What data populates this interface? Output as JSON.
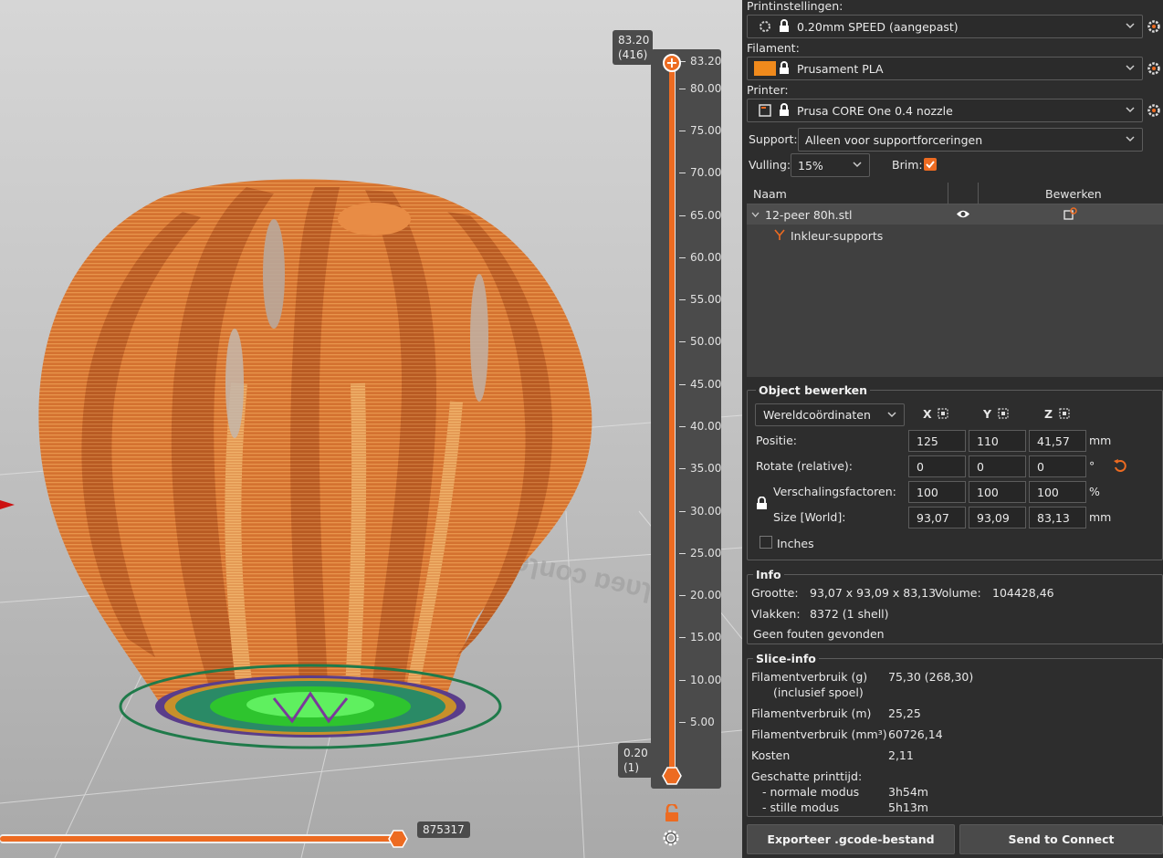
{
  "viewport": {
    "layer_slider": {
      "top_value": "83.20",
      "top_layer": "(416)",
      "bottom_value": "0.20",
      "bottom_layer": "(1)",
      "ticks": [
        "83.20",
        "80.00",
        "75.00",
        "70.00",
        "65.00",
        "60.00",
        "55.00",
        "50.00",
        "45.00",
        "40.00",
        "35.00",
        "30.00",
        "25.00",
        "20.00",
        "15.00",
        "10.00",
        "5.00"
      ]
    },
    "move_slider": {
      "value": "875317"
    },
    "bed_label": "ɿəɿuoɔ ɒɘυɿq"
  },
  "sidebar": {
    "print_settings": {
      "label": "Printinstellingen:",
      "value": "0.20mm SPEED (aangepast)"
    },
    "filament": {
      "label": "Filament:",
      "value": "Prusament PLA",
      "color": "#f08a1c"
    },
    "printer": {
      "label": "Printer:",
      "value": "Prusa CORE One 0.4 nozzle"
    },
    "support": {
      "label": "Support:",
      "value": "Alleen voor supportforceringen"
    },
    "infill": {
      "label": "Vulling:",
      "value": "15%"
    },
    "brim": {
      "label": "Brim:",
      "checked": true
    },
    "object_list": {
      "headers": [
        "Naam",
        "Bewerken"
      ],
      "object_name": "12-peer 80h.stl",
      "child_name": "Inkleur-supports"
    },
    "object_edit": {
      "title": "Object bewerken",
      "coord_system": "Wereldcoördinaten",
      "axes": [
        "X",
        "Y",
        "Z"
      ],
      "position_label": "Positie:",
      "position": [
        "125",
        "110",
        "41,57"
      ],
      "position_unit": "mm",
      "rotate_label": "Rotate (relative):",
      "rotate": [
        "0",
        "0",
        "0"
      ],
      "rotate_unit": "°",
      "scale_label": "Verschalingsfactoren:",
      "scale": [
        "100",
        "100",
        "100"
      ],
      "scale_unit": "%",
      "size_label": "Size [World]:",
      "size": [
        "93,07",
        "93,09",
        "83,13"
      ],
      "size_unit": "mm",
      "inches_label": "Inches"
    },
    "info": {
      "title": "Info",
      "size_label": "Grootte:",
      "size_value": "93,07 x 93,09 x 83,13",
      "volume_label": "Volume:",
      "volume_value": "104428,46",
      "facets_label": "Vlakken:",
      "facets_value": "8372 (1 shell)",
      "errors": "Geen fouten gevonden"
    },
    "slice_info": {
      "title": "Slice-info",
      "rows": [
        {
          "label": "Filamentverbruik (g)",
          "value": "75,30 (268,30)"
        },
        {
          "label": "(inclusief spoel)",
          "value": ""
        },
        {
          "label": "Filamentverbruik (m)",
          "value": "25,25"
        },
        {
          "label": "Filamentverbruik (mm³)",
          "value": "60726,14"
        },
        {
          "label": "Kosten",
          "value": "2,11"
        },
        {
          "label": "Geschatte printtijd:",
          "value": ""
        },
        {
          "label": "- normale modus",
          "value": "3h54m"
        },
        {
          "label": "- stille modus",
          "value": "5h13m"
        }
      ]
    },
    "buttons": {
      "export": "Exporteer .gcode-bestand",
      "connect": "Send to Connect"
    }
  },
  "colors": {
    "accent": "#ed6b21",
    "print_orange": "#d9702c",
    "support_green": "#3fd23f"
  }
}
